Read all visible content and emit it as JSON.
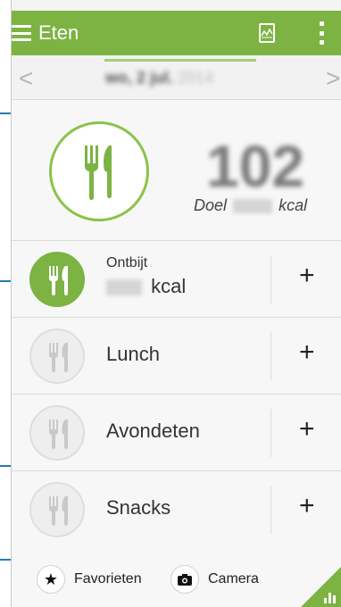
{
  "app": {
    "title": "Eten"
  },
  "date_bar": {
    "date": "wo, 2 jul.",
    "year": "2014",
    "prev": "<",
    "next": ">"
  },
  "summary": {
    "calories": "102",
    "goal_prefix": "Doel",
    "goal_suffix": "kcal"
  },
  "meals": [
    {
      "name": "Ontbijt",
      "kcal_unit": "kcal",
      "active": true
    },
    {
      "name": "Lunch",
      "active": false
    },
    {
      "name": "Avondeten",
      "active": false
    },
    {
      "name": "Snacks",
      "active": false
    }
  ],
  "add_label": "+",
  "bottom": {
    "favorites_label": "Favorieten",
    "camera_label": "Camera"
  },
  "colors": {
    "accent": "#7cb342",
    "callout": "#1f7fa8"
  }
}
